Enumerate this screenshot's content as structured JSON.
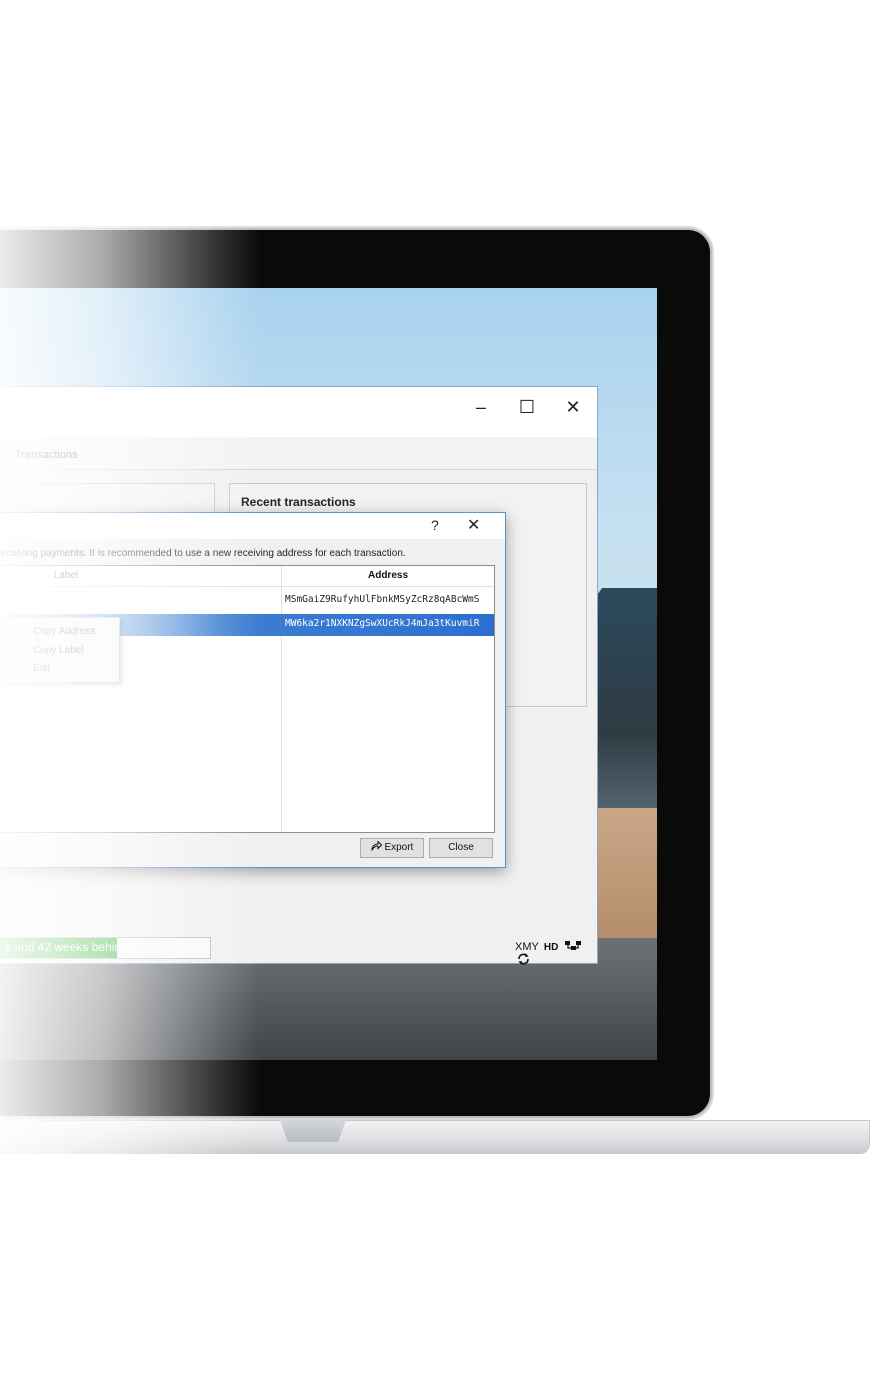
{
  "main_window": {
    "buttons": {
      "minimize": "–",
      "maximize": "☐",
      "close": "✕"
    },
    "tab_transactions": "Transactions",
    "recent_transactions_title": "Recent transactions",
    "status": {
      "sync_text": "s and 42 weeks behind",
      "sync_progress_percent": 58,
      "unit": "XMY",
      "hd": "HD"
    }
  },
  "dialog": {
    "help": "?",
    "close": "✕",
    "description": "eceiving payments. It is recommended to use a new receiving address for each transaction.",
    "columns": {
      "label": "Label",
      "address": "Address"
    },
    "rows": [
      {
        "label": "",
        "address": "MSmGaiZ9RufyhUlFbnkMSyZcRz8qABcWmS",
        "selected": false
      },
      {
        "label": "",
        "address": "MW6ka2r1NXKNZgSwXUcRkJ4mJa3tKuvmiR",
        "selected": true
      }
    ],
    "context_menu": [
      "Copy Address",
      "Copy Label",
      "Edit"
    ],
    "export_button": "Export",
    "close_button": "Close"
  }
}
